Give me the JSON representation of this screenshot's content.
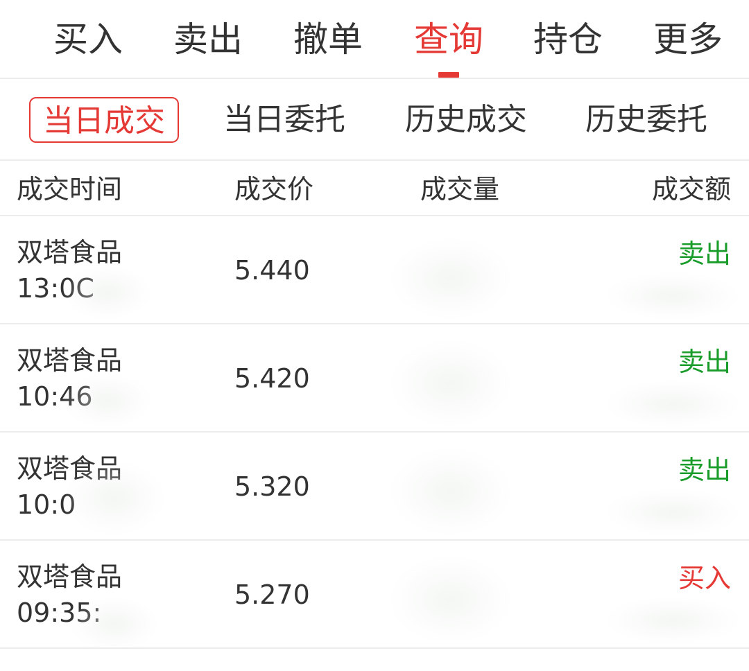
{
  "top_tabs": [
    {
      "label": "买入"
    },
    {
      "label": "卖出"
    },
    {
      "label": "撤单"
    },
    {
      "label": "查询"
    },
    {
      "label": "持仓"
    },
    {
      "label": "更多"
    }
  ],
  "active_top_tab": "查询",
  "sub_tabs": [
    {
      "label": "当日成交"
    },
    {
      "label": "当日委托"
    },
    {
      "label": "历史成交"
    },
    {
      "label": "历史委托"
    }
  ],
  "active_sub_tab": "当日成交",
  "table": {
    "headers": {
      "time": "成交时间",
      "price": "成交价",
      "qty": "成交量",
      "amount": "成交额"
    },
    "rows": [
      {
        "name": "双塔食品",
        "time": "13:0C",
        "price": "5.440",
        "direction": "卖出"
      },
      {
        "name": "双塔食品",
        "time": "10:46",
        "price": "5.420",
        "direction": "卖出"
      },
      {
        "name": "双塔食品",
        "time": "10:0",
        "price": "5.320",
        "direction": "卖出"
      },
      {
        "name": "双塔食品",
        "time": "09:35:",
        "price": "5.270",
        "direction": "买入"
      }
    ]
  },
  "colors": {
    "accent": "#e53935",
    "sell": "#1a9c2a",
    "buy": "#e53935",
    "divider": "#ececec"
  }
}
